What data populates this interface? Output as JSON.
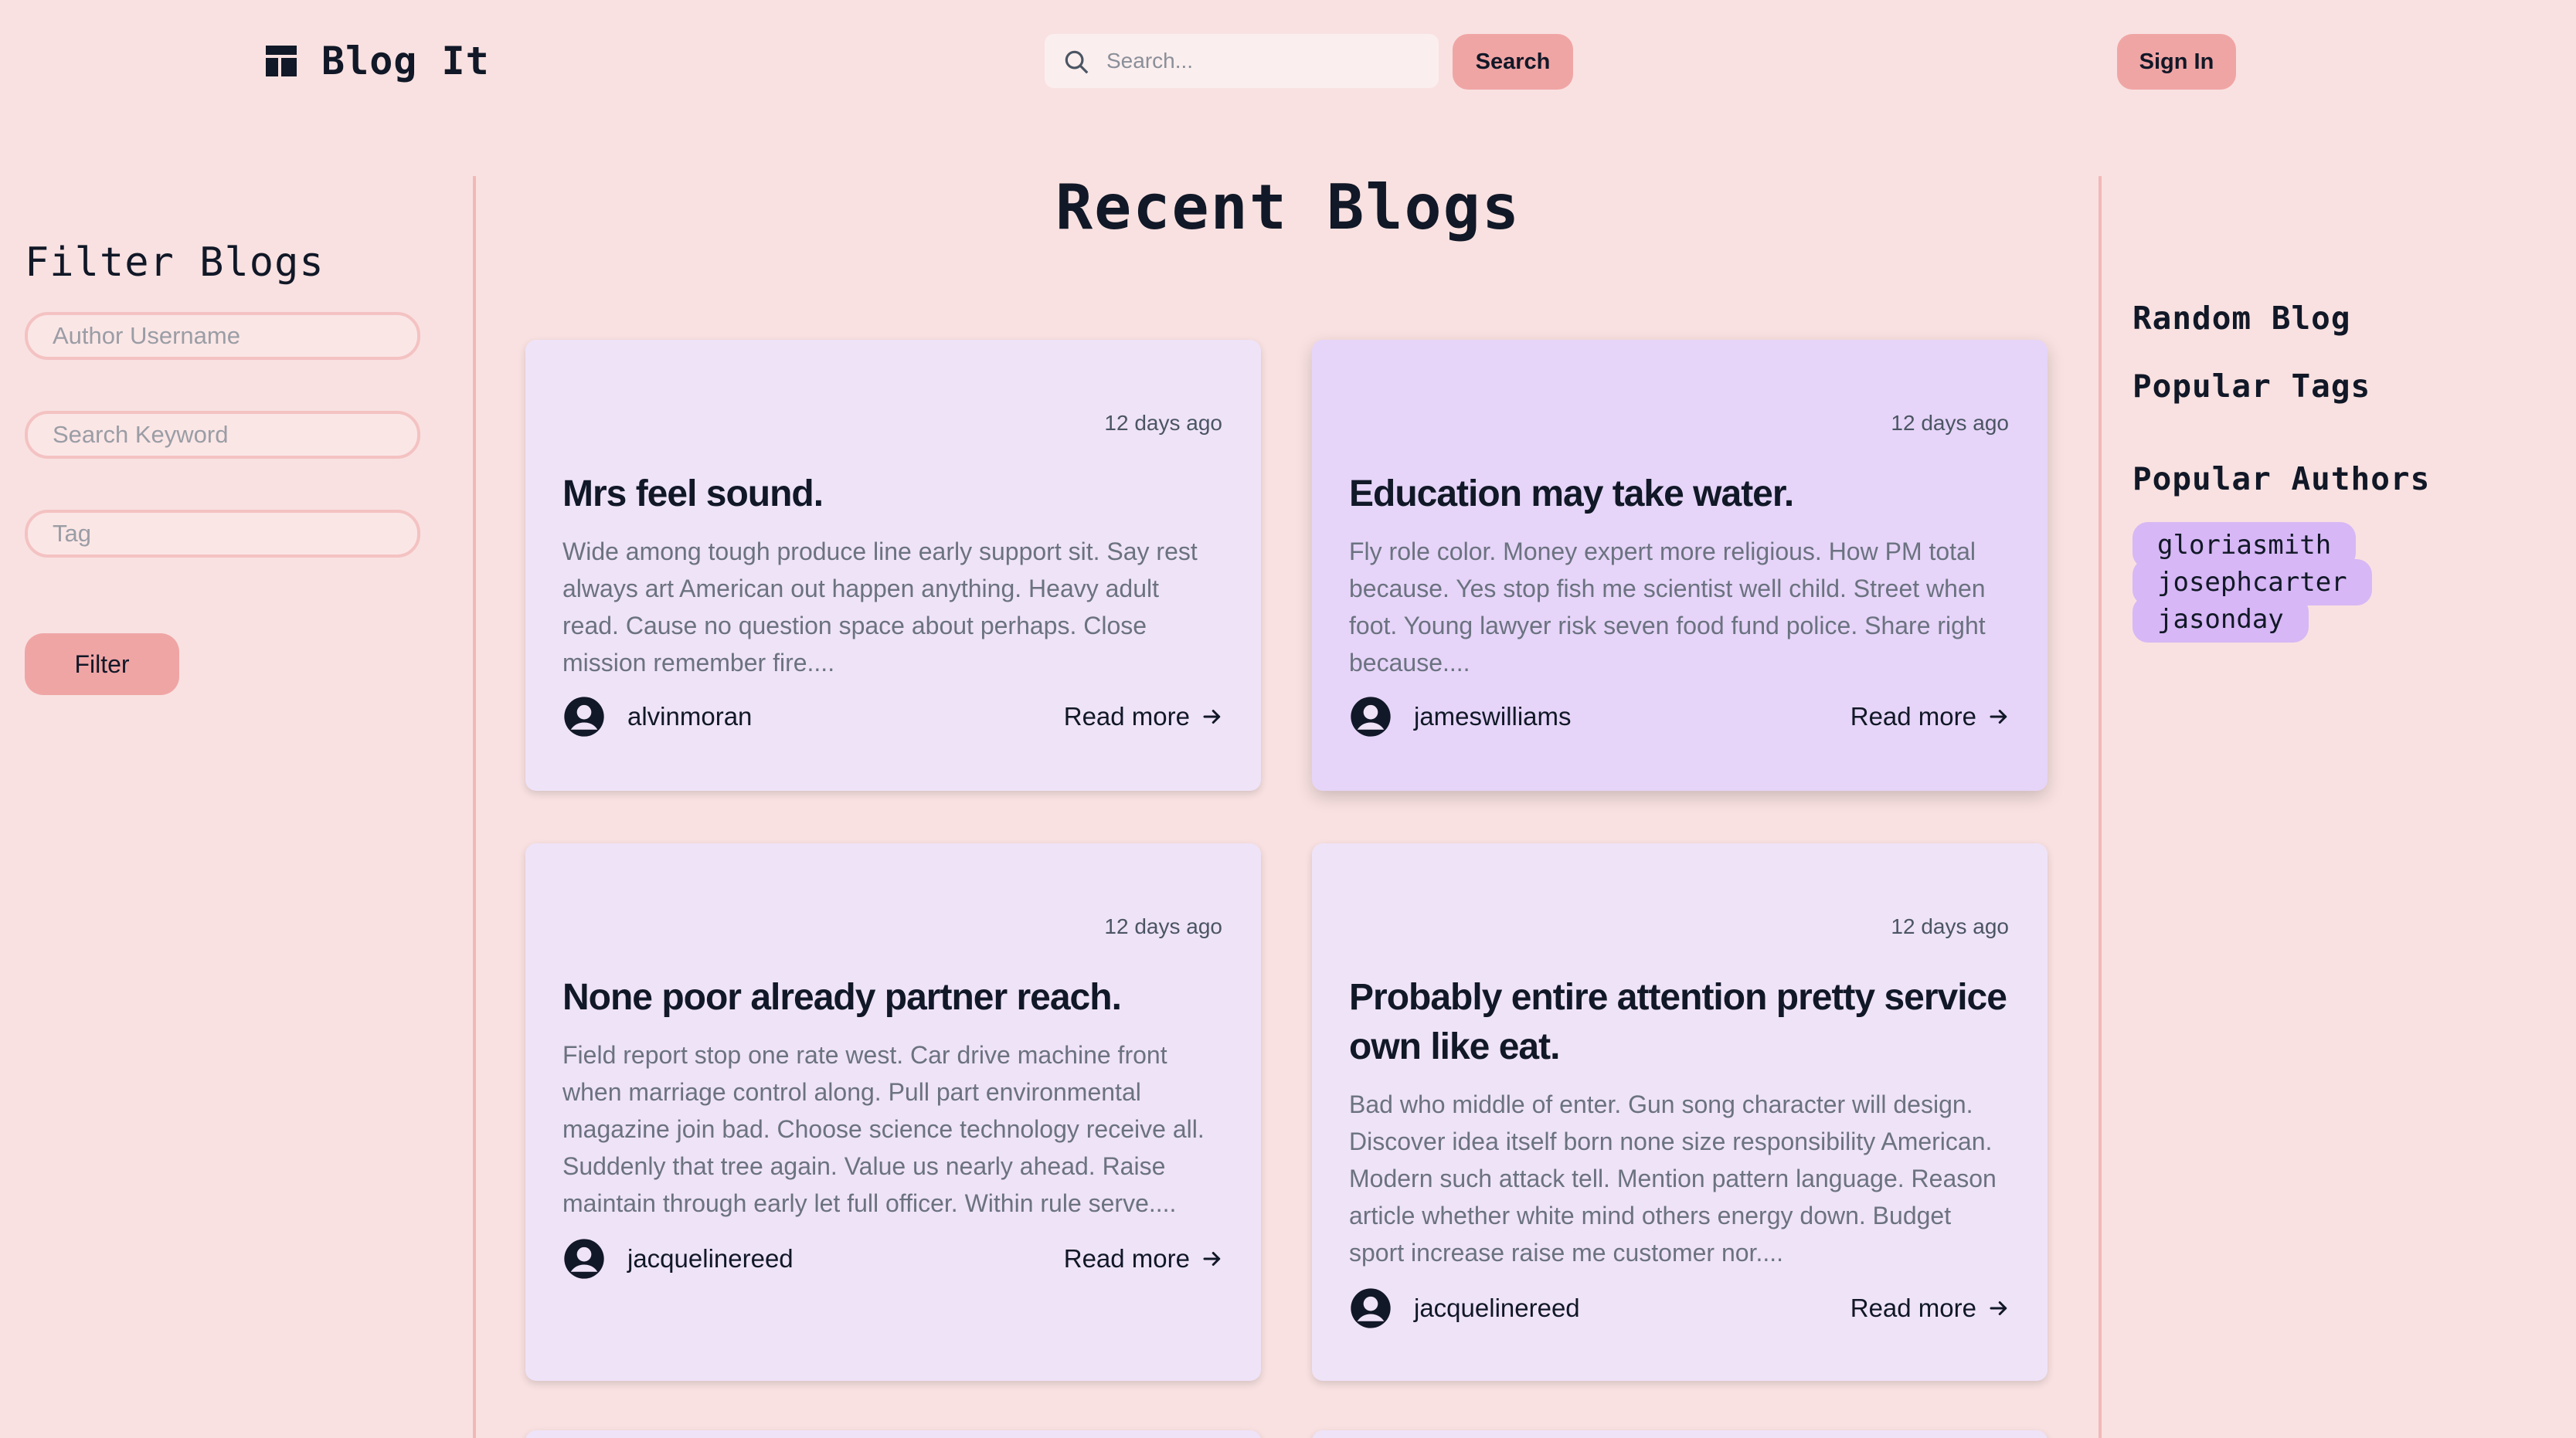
{
  "header": {
    "logo_text": "Blog It",
    "search_placeholder": "Search...",
    "search_button": "Search",
    "signin_button": "Sign In"
  },
  "filter": {
    "title": "Filter Blogs",
    "author_placeholder": "Author Username",
    "keyword_placeholder": "Search Keyword",
    "tag_placeholder": "Tag",
    "button": "Filter"
  },
  "main": {
    "title": "Recent Blogs",
    "read_more": "Read more",
    "cards": [
      {
        "date": "12 days ago",
        "title": "Mrs feel sound.",
        "body": "Wide among tough produce line early support sit. Say rest always art American out happen anything. Heavy adult read. Cause no question space about perhaps. Close mission remember fire....",
        "author": "alvinmoran"
      },
      {
        "date": "12 days ago",
        "title": "Education may take water.",
        "body": "Fly role color. Money expert more religious. How PM total because. Yes stop fish me scientist well child. Street when foot. Young lawyer risk seven food fund police. Share right because....",
        "author": "jameswilliams"
      },
      {
        "date": "12 days ago",
        "title": "None poor already partner reach.",
        "body": "Field report stop one rate west. Car drive machine front when marriage control along. Pull part environmental magazine join bad. Choose science technology receive all. Suddenly that tree again. Value us nearly ahead. Raise maintain through early let full officer. Within rule serve....",
        "author": "jacquelinereed"
      },
      {
        "date": "12 days ago",
        "title": "Probably entire attention pretty service own like eat.",
        "body": "Bad who middle of enter. Gun song character will design. Discover idea itself born none size responsibility American. Modern such attack tell. Mention pattern language. Reason article whether white mind others energy down. Budget sport increase raise me customer nor....",
        "author": "jacquelinereed"
      }
    ]
  },
  "sidebar": {
    "random_blog": "Random Blog",
    "popular_tags": "Popular Tags",
    "popular_authors": "Popular Authors",
    "authors": [
      "gloriasmith",
      "josephcarter",
      "jasonday"
    ]
  },
  "colors": {
    "background": "#f9e1e1",
    "accent": "#f0a5a5",
    "card": "#efe3f8",
    "card_highlight": "#e6d5f8",
    "author_pill": "#d7b7f5"
  }
}
